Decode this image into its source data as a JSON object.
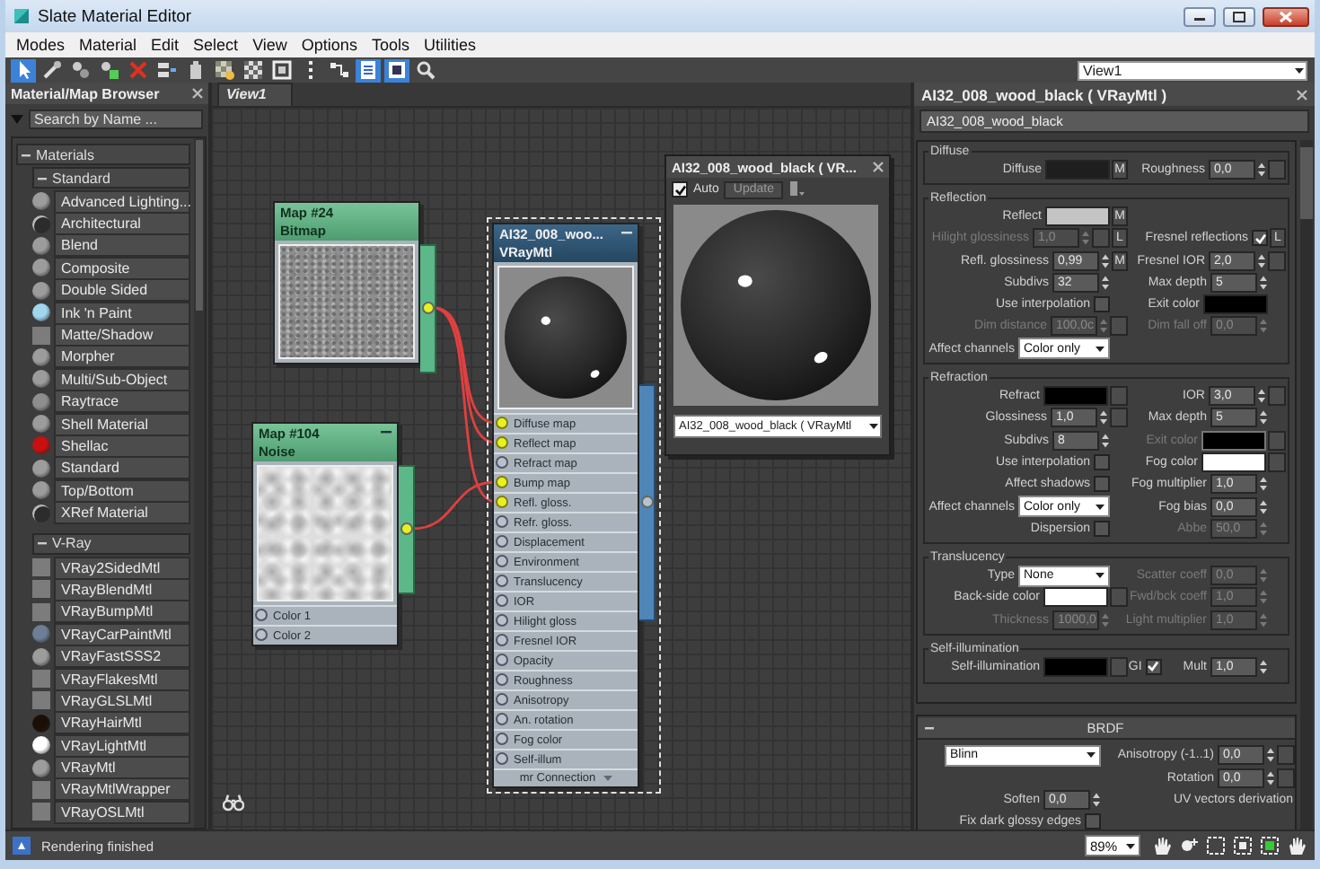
{
  "window": {
    "title": "Slate Material Editor"
  },
  "menu": [
    "Modes",
    "Material",
    "Edit",
    "Select",
    "View",
    "Options",
    "Tools",
    "Utilities"
  ],
  "toolbar": [
    {
      "kind": "select",
      "selected": true
    },
    {
      "kind": "pick",
      "selected": false
    },
    {
      "kind": "assign",
      "selected": false
    },
    {
      "kind": "put",
      "selected": false
    },
    {
      "kind": "delete",
      "selected": false
    },
    {
      "kind": "layout",
      "selected": false
    },
    {
      "kind": "save",
      "selected": false
    },
    {
      "kind": "show-map",
      "selected": false
    },
    {
      "kind": "checker",
      "selected": false
    },
    {
      "kind": "background",
      "selected": false
    },
    {
      "kind": "layout-all",
      "selected": false
    },
    {
      "kind": "children",
      "selected": false
    },
    {
      "kind": "params",
      "selected": true
    },
    {
      "kind": "preview",
      "selected": true
    },
    {
      "kind": "find",
      "selected": false
    }
  ],
  "view_select": {
    "value": "View1"
  },
  "browser": {
    "title": "Material/Map Browser",
    "search": {
      "placeholder": "Search by Name ..."
    },
    "tree": [
      {
        "label": "Materials",
        "expanded": true,
        "children": [
          {
            "label": "Standard",
            "expanded": true,
            "children": [
              {
                "label": "Advanced Lighting...",
                "kind": "sphere",
                "color": "#9c9c9c"
              },
              {
                "label": "Architectural",
                "kind": "ring",
                "color": "#2c2c2c"
              },
              {
                "label": "Blend",
                "kind": "sphere",
                "color": "#9c9c9c"
              },
              {
                "label": "Composite",
                "kind": "sphere",
                "color": "#9c9c9c"
              },
              {
                "label": "Double Sided",
                "kind": "sphere",
                "color": "#9c9c9c"
              },
              {
                "label": "Ink 'n Paint",
                "kind": "sphere",
                "color": "#9fd6f0"
              },
              {
                "label": "Matte/Shadow",
                "kind": "flat",
                "color": "#7c7c7c"
              },
              {
                "label": "Morpher",
                "kind": "sphere",
                "color": "#9c9c9c"
              },
              {
                "label": "Multi/Sub-Object",
                "kind": "sphere",
                "color": "#9c9c9c"
              },
              {
                "label": "Raytrace",
                "kind": "sphere",
                "color": "#8e8e8e"
              },
              {
                "label": "Shell Material",
                "kind": "sphere",
                "color": "#9c9c9c"
              },
              {
                "label": "Shellac",
                "kind": "sphere",
                "color": "#c81010"
              },
              {
                "label": "Standard",
                "kind": "sphere",
                "color": "#9c9c9c"
              },
              {
                "label": "Top/Bottom",
                "kind": "sphere",
                "color": "#9c9c9c"
              },
              {
                "label": "XRef Material",
                "kind": "ring",
                "color": "#2c2c2c"
              }
            ]
          },
          {
            "label": "V-Ray",
            "expanded": true,
            "children": [
              {
                "label": "VRay2SidedMtl",
                "kind": "flat",
                "color": "#7c7c7c"
              },
              {
                "label": "VRayBlendMtl",
                "kind": "flat",
                "color": "#7c7c7c"
              },
              {
                "label": "VRayBumpMtl",
                "kind": "flat",
                "color": "#7c7c7c"
              },
              {
                "label": "VRayCarPaintMtl",
                "kind": "sphere",
                "color": "#6d7e96"
              },
              {
                "label": "VRayFastSSS2",
                "kind": "sphere",
                "color": "#9c9c9c"
              },
              {
                "label": "VRayFlakesMtl",
                "kind": "flat",
                "color": "#7c7c7c"
              },
              {
                "label": "VRayGLSLMtl",
                "kind": "flat",
                "color": "#7c7c7c"
              },
              {
                "label": "VRayHairMtl",
                "kind": "sphere",
                "color": "#1a0f06"
              },
              {
                "label": "VRayLightMtl",
                "kind": "sphere",
                "color": "#ffffff"
              },
              {
                "label": "VRayMtl",
                "kind": "sphere",
                "color": "#9c9c9c"
              },
              {
                "label": "VRayMtlWrapper",
                "kind": "flat",
                "color": "#7c7c7c"
              },
              {
                "label": "VRayOSLMtl",
                "kind": "flat",
                "color": "#7c7c7c"
              }
            ]
          }
        ]
      }
    ]
  },
  "view_tabs": [
    {
      "label": "View1",
      "selected": true
    }
  ],
  "nodes": [
    {
      "title": "Map #24",
      "type": "Bitmap",
      "kind": "map",
      "selected": false
    },
    {
      "title": "Map #104",
      "type": "Noise",
      "kind": "map",
      "selected": false,
      "slots": [
        {
          "label": "Color 1",
          "connected": false
        },
        {
          "label": "Color 2",
          "connected": false
        }
      ]
    },
    {
      "title": "AI32_008_woo...",
      "type": "VRayMtl",
      "kind": "material",
      "selected": true,
      "footer": "mr Connection",
      "slots": [
        {
          "label": "Diffuse map",
          "connected": true
        },
        {
          "label": "Reflect map",
          "connected": true
        },
        {
          "label": "Refract map",
          "connected": false
        },
        {
          "label": "Bump map",
          "connected": true
        },
        {
          "label": "Refl. gloss.",
          "connected": true
        },
        {
          "label": "Refr. gloss.",
          "connected": false
        },
        {
          "label": "Displacement",
          "connected": false
        },
        {
          "label": "Environment",
          "connected": false
        },
        {
          "label": "Translucency",
          "connected": false
        },
        {
          "label": "IOR",
          "connected": false
        },
        {
          "label": "Hilight gloss",
          "connected": false
        },
        {
          "label": "Fresnel IOR",
          "connected": false
        },
        {
          "label": "Opacity",
          "connected": false
        },
        {
          "label": "Roughness",
          "connected": false
        },
        {
          "label": "Anisotropy",
          "connected": false
        },
        {
          "label": "An. rotation",
          "connected": false
        },
        {
          "label": "Fog color",
          "connected": false
        },
        {
          "label": "Self-illum",
          "connected": false
        }
      ]
    }
  ],
  "preview_window": {
    "title": "AI32_008_wood_black  ( VR...",
    "auto": {
      "label": "Auto",
      "checked": true
    },
    "update": "Update",
    "material": "AI32_008_wood_black  ( VRayMtl"
  },
  "params": {
    "title": "AI32_008_wood_black  ( VRayMtl )",
    "name": "AI32_008_wood_black",
    "groups": [
      {
        "title": "Diffuse",
        "rows": [
          {
            "left": [
              {
                "label": "Diffuse",
                "kind": "color",
                "color": "#1e1e1e",
                "button": "M",
                "disabled": false
              }
            ],
            "right": [
              {
                "label": "Roughness",
                "kind": "spinner",
                "value": "0,0",
                "slot": true,
                "disabled": false
              }
            ]
          }
        ]
      },
      {
        "title": "Reflection",
        "rows": [
          {
            "left": [
              {
                "label": "Reflect",
                "kind": "color",
                "color": "#c4c4c4",
                "button": "M",
                "disabled": false
              }
            ],
            "right": []
          },
          {
            "left": [
              {
                "label": "Hilight glossiness",
                "kind": "spinner",
                "value": "1,0",
                "slot": true,
                "button": "L",
                "disabled": true
              }
            ],
            "right": [
              {
                "label": "Fresnel reflections",
                "kind": "check",
                "checked": true,
                "button": "L",
                "disabled": false
              }
            ]
          },
          {
            "left": [
              {
                "label": "Refl. glossiness",
                "kind": "spinner",
                "value": "0,99",
                "button": "M",
                "disabled": false
              }
            ],
            "right": [
              {
                "label": "Fresnel IOR",
                "kind": "spinner",
                "value": "2,0",
                "slot": true,
                "disabled": false
              }
            ]
          },
          {
            "left": [
              {
                "label": "Subdivs",
                "kind": "spinner",
                "value": "32",
                "disabled": false
              }
            ],
            "right": [
              {
                "label": "Max depth",
                "kind": "spinner",
                "value": "5",
                "disabled": false
              }
            ]
          },
          {
            "left": [
              {
                "label": "Use interpolation",
                "kind": "check",
                "checked": false,
                "disabled": false
              }
            ],
            "right": [
              {
                "label": "Exit color",
                "kind": "color",
                "color": "#000000",
                "disabled": false
              }
            ]
          },
          {
            "left": [
              {
                "label": "Dim distance",
                "kind": "spinner",
                "value": "100,0c",
                "slot": true,
                "disabled": true
              }
            ],
            "right": [
              {
                "label": "Dim fall off",
                "kind": "spinner",
                "value": "0,0",
                "disabled": true
              }
            ]
          },
          {
            "left": [
              {
                "label": "Affect channels",
                "kind": "dropdown",
                "value": "Color only",
                "disabled": false
              }
            ],
            "right": []
          }
        ]
      },
      {
        "title": "Refraction",
        "rows": [
          {
            "left": [
              {
                "label": "Refract",
                "kind": "color",
                "color": "#000000",
                "slot": true,
                "disabled": false
              }
            ],
            "right": [
              {
                "label": "IOR",
                "kind": "spinner",
                "value": "3,0",
                "slot": true,
                "disabled": false
              }
            ]
          },
          {
            "left": [
              {
                "label": "Glossiness",
                "kind": "spinner",
                "value": "1,0",
                "slot": true,
                "disabled": false
              }
            ],
            "right": [
              {
                "label": "Max depth",
                "kind": "spinner",
                "value": "5",
                "disabled": false
              }
            ]
          },
          {
            "left": [
              {
                "label": "Subdivs",
                "kind": "spinner",
                "value": "8",
                "disabled": false
              }
            ],
            "right": [
              {
                "label": "Exit color",
                "kind": "color",
                "color": "#000000",
                "slot": true,
                "disabled": true
              }
            ]
          },
          {
            "left": [
              {
                "label": "Use interpolation",
                "kind": "check",
                "checked": false,
                "disabled": false
              }
            ],
            "right": [
              {
                "label": "Fog color",
                "kind": "color",
                "color": "#ffffff",
                "slot": true,
                "disabled": false
              }
            ]
          },
          {
            "left": [
              {
                "label": "Affect shadows",
                "kind": "check",
                "checked": false,
                "disabled": false
              }
            ],
            "right": [
              {
                "label": "Fog multiplier",
                "kind": "spinner",
                "value": "1,0",
                "disabled": false
              }
            ]
          },
          {
            "left": [
              {
                "label": "Affect channels",
                "kind": "dropdown",
                "value": "Color only",
                "disabled": false
              }
            ],
            "right": [
              {
                "label": "Fog bias",
                "kind": "spinner",
                "value": "0,0",
                "disabled": false
              }
            ]
          },
          {
            "left": [
              {
                "label": "Dispersion",
                "kind": "check",
                "checked": false,
                "disabled": false
              }
            ],
            "right": [
              {
                "label": "Abbe",
                "kind": "spinner",
                "value": "50,0",
                "disabled": true
              }
            ]
          }
        ]
      },
      {
        "title": "Translucency",
        "rows": [
          {
            "left": [
              {
                "label": "Type",
                "kind": "dropdown",
                "value": "None",
                "disabled": false
              }
            ],
            "right": [
              {
                "label": "Scatter coeff",
                "kind": "spinner",
                "value": "0,0",
                "disabled": true
              }
            ]
          },
          {
            "left": [
              {
                "label": "Back-side color",
                "kind": "color",
                "color": "#ffffff",
                "slot": true,
                "disabled": false
              }
            ],
            "right": [
              {
                "label": "Fwd/bck coeff",
                "kind": "spinner",
                "value": "1,0",
                "disabled": true
              }
            ]
          },
          {
            "left": [
              {
                "label": "Thickness",
                "kind": "spinner",
                "value": "1000,0",
                "disabled": true
              }
            ],
            "right": [
              {
                "label": "Light multiplier",
                "kind": "spinner",
                "value": "1,0",
                "disabled": true
              }
            ]
          }
        ]
      },
      {
        "title": "Self-illumination",
        "rows": [
          {
            "left": [
              {
                "label": "Self-illumination",
                "kind": "color",
                "color": "#000000",
                "slot": true,
                "disabled": false
              }
            ],
            "right": [
              {
                "label": "GI",
                "kind": "check",
                "checked": true,
                "disabled": false
              },
              {
                "label": "Mult",
                "kind": "spinner",
                "value": "1,0",
                "disabled": false
              }
            ]
          }
        ]
      }
    ],
    "brdf": {
      "title": "BRDF",
      "expanded": true,
      "rows": [
        {
          "left": [
            {
              "kind": "dropdown",
              "value": "Blinn",
              "disabled": false
            }
          ],
          "right": [
            {
              "label": "Anisotropy (-1..1)",
              "kind": "spinner",
              "value": "0,0",
              "slot": true
            }
          ]
        },
        {
          "left": [],
          "right": [
            {
              "label": "Rotation",
              "kind": "spinner",
              "value": "0,0",
              "slot": true
            }
          ]
        },
        {
          "left": [
            {
              "label": "Soften",
              "kind": "spinner",
              "value": "0,0",
              "disabled": false
            }
          ],
          "right": [
            {
              "label": "UV vectors derivation",
              "kind": "caption"
            }
          ]
        },
        {
          "left": [
            {
              "label": "Fix dark glossy edges",
              "kind": "check",
              "checked": false,
              "disabled": false
            }
          ],
          "right": []
        }
      ]
    }
  },
  "status": {
    "text": "Rendering finished"
  },
  "zoom": {
    "value": "89%"
  }
}
